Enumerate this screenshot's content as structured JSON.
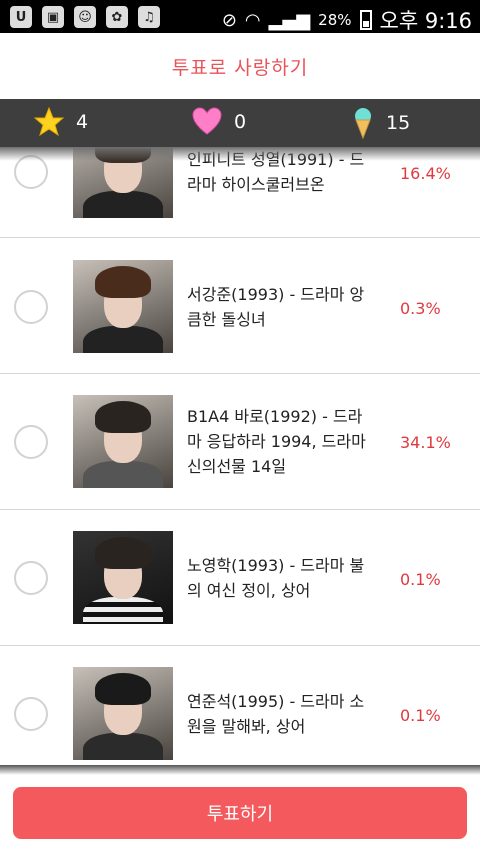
{
  "status_bar": {
    "battery_percent": "28%",
    "time": "오후 9:16"
  },
  "header": {
    "title": "투표로 사랑하기"
  },
  "counters": [
    {
      "icon": "star-icon",
      "value": "4"
    },
    {
      "icon": "heart-icon",
      "value": "0"
    },
    {
      "icon": "ice-cream-icon",
      "value": "15"
    }
  ],
  "list": {
    "items": [
      {
        "desc_line1": "인피니트 성열(1991) - 드",
        "desc_line2": "라마 하이스쿨러브온",
        "desc_line3": "",
        "percent": "16.4%"
      },
      {
        "desc_line1": "서강준(1993) - 드라마 앙",
        "desc_line2": "큼한 돌싱녀",
        "desc_line3": "",
        "percent": "0.3%"
      },
      {
        "desc_line1": "B1A4 바로(1992) - 드라",
        "desc_line2": "마 응답하라 1994, 드라마",
        "desc_line3": "신의선물 14일",
        "percent": "34.1%"
      },
      {
        "desc_line1": "노영학(1993) - 드라마 불",
        "desc_line2": "의 여신 정이, 상어",
        "desc_line3": "",
        "percent": "0.1%"
      },
      {
        "desc_line1": "연준석(1995) - 드라마 소",
        "desc_line2": "원을 말해봐, 상어",
        "desc_line3": "",
        "percent": "0.1%"
      }
    ]
  },
  "vote_button": {
    "label": "투표하기"
  }
}
